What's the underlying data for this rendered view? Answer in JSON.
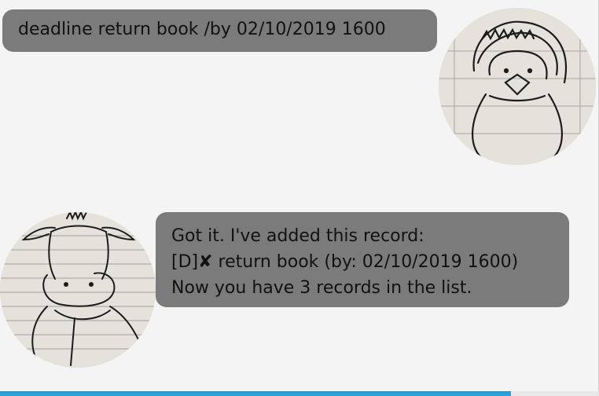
{
  "chat": {
    "user_message": {
      "text": "deadline return book /by 02/10/2019 1600",
      "avatar_icon": "penguin-sketch-avatar"
    },
    "bot_message": {
      "lines": [
        "Got it. I've added this record:",
        "[D]✘ return book (by: 02/10/2019 1600)",
        "Now you have 3 records in the list."
      ],
      "avatar_icon": "cow-sketch-avatar"
    }
  },
  "colors": {
    "background": "#f4f4f4",
    "bubble": "#7b7b7b",
    "bubble_text": "#111111",
    "accent_bar": "#2aa3d8"
  }
}
